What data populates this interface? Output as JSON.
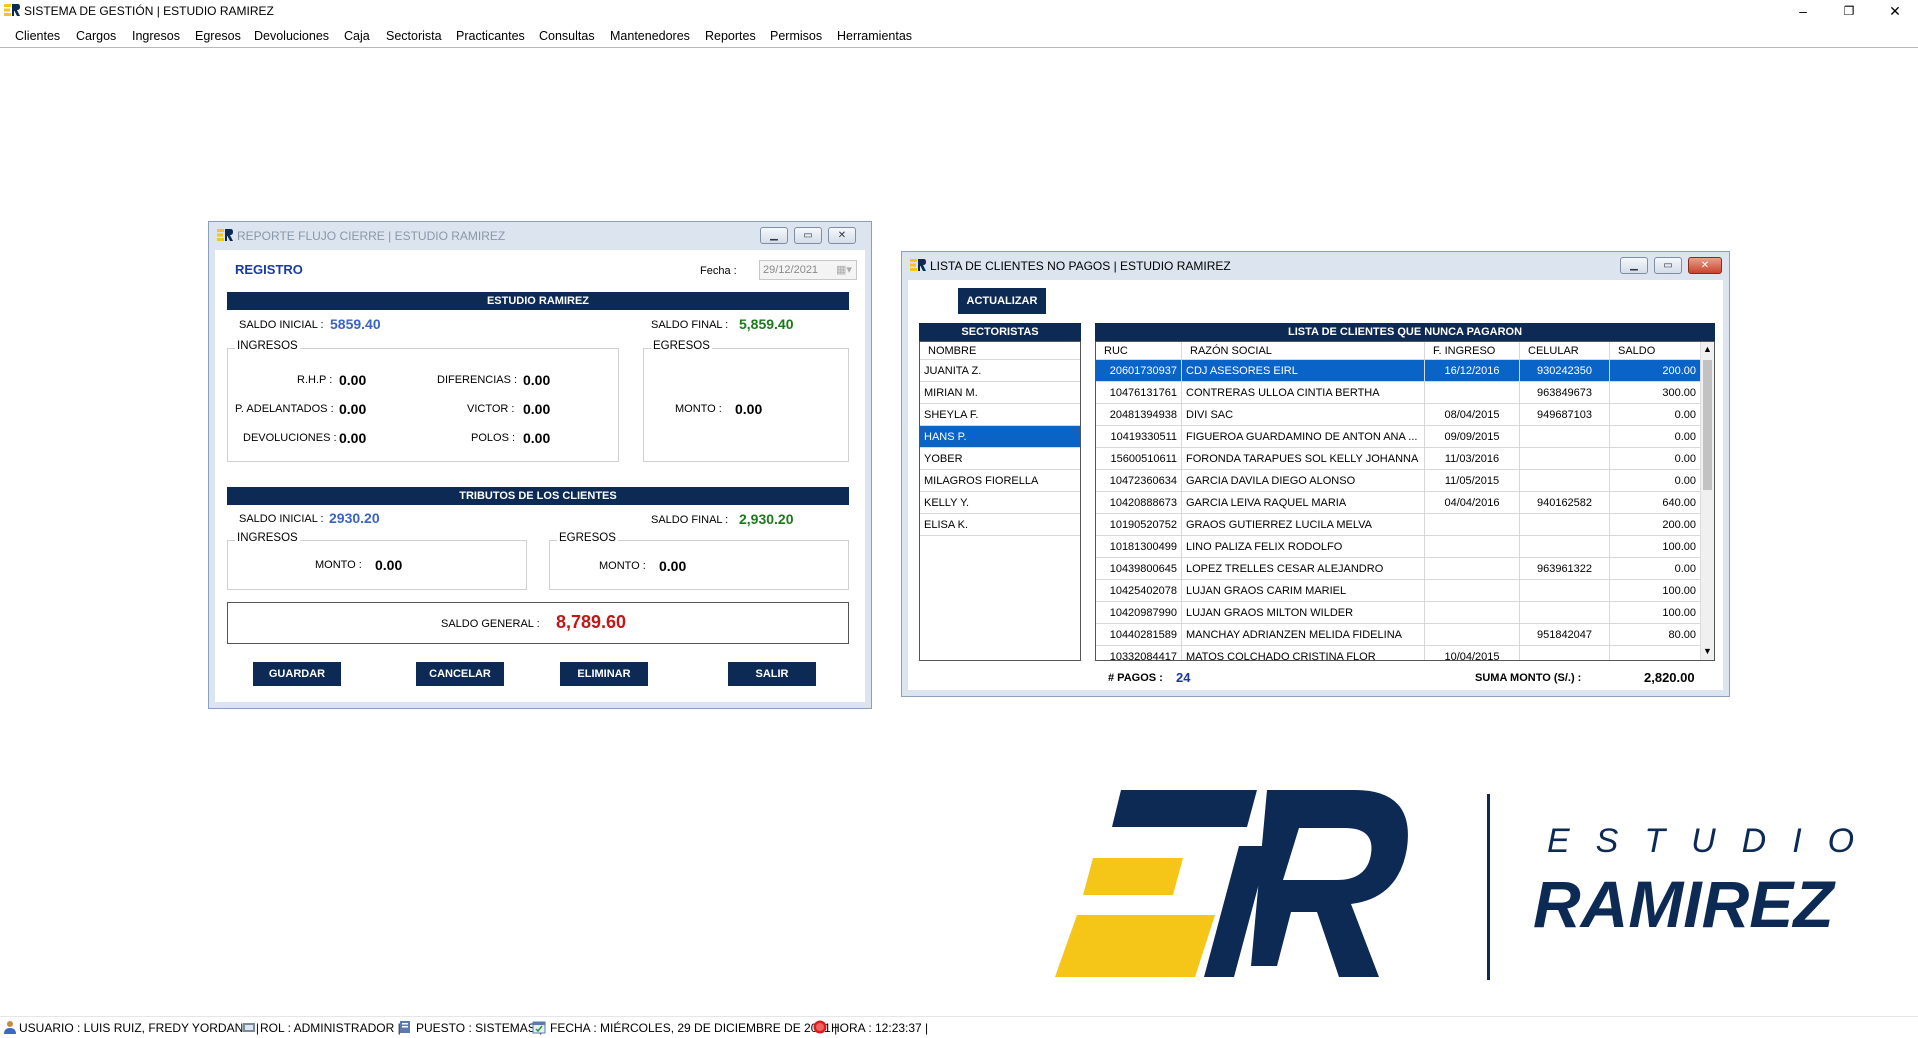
{
  "app": {
    "title": "SISTEMA DE GESTIÓN | ESTUDIO RAMIREZ",
    "menu": [
      "Clientes",
      "Cargos",
      "Ingresos",
      "Egresos",
      "Devoluciones",
      "Caja",
      "Sectorista",
      "Practicantes",
      "Consultas",
      "Mantenedores",
      "Reportes",
      "Permisos",
      "Herramientas"
    ],
    "window_controls": {
      "minimize": "–",
      "restore": "❐",
      "close": "✕"
    }
  },
  "report": {
    "title": "REPORTE FLUJO CIERRE | ESTUDIO RAMIREZ",
    "heading": "REGISTRO",
    "fecha_label": "Fecha :",
    "fecha_value": "29/12/2021",
    "estudio": {
      "bar": "ESTUDIO RAMIREZ",
      "saldo_inicial_label": "SALDO INICIAL :",
      "saldo_inicial": "5859.40",
      "saldo_final_label": "SALDO FINAL :",
      "saldo_final": "5,859.40",
      "ingresos_title": "INGRESOS",
      "rhp_label": "R.H.P :",
      "rhp": "0.00",
      "diferencias_label": "DIFERENCIAS :",
      "diferencias": "0.00",
      "adelantados_label": "P. ADELANTADOS :",
      "adelantados": "0.00",
      "victor_label": "VICTOR :",
      "victor": "0.00",
      "devoluciones_label": "DEVOLUCIONES :",
      "devoluciones": "0.00",
      "polos_label": "POLOS :",
      "polos": "0.00",
      "egresos_title": "EGRESOS",
      "monto_label": "MONTO :",
      "monto": "0.00"
    },
    "tributos": {
      "bar": "TRIBUTOS DE LOS CLIENTES",
      "saldo_inicial_label": "SALDO INICIAL :",
      "saldo_inicial": "2930.20",
      "saldo_final_label": "SALDO FINAL :",
      "saldo_final": "2,930.20",
      "ingresos_title": "INGRESOS",
      "ing_monto_label": "MONTO :",
      "ing_monto": "0.00",
      "egresos_title": "EGRESOS",
      "eg_monto_label": "MONTO :",
      "eg_monto": "0.00"
    },
    "saldo_general_label": "SALDO GENERAL :",
    "saldo_general": "8,789.60",
    "buttons": {
      "guardar": "GUARDAR",
      "cancelar": "CANCELAR",
      "eliminar": "ELIMINAR",
      "salir": "SALIR"
    }
  },
  "clients": {
    "title": "LISTA DE CLIENTES NO PAGOS | ESTUDIO RAMIREZ",
    "actualizar": "ACTUALIZAR",
    "sectoristas_bar": "SECTORISTAS",
    "sectoristas_header": "NOMBRE",
    "sectoristas": [
      "JUANITA Z.",
      "MIRIAN M.",
      "SHEYLA F.",
      "HANS P.",
      "YOBER",
      "MILAGROS FIORELLA",
      "KELLY Y.",
      "ELISA K."
    ],
    "selected_sectorista": 3,
    "list_bar": "LISTA DE CLIENTES QUE NUNCA PAGARON",
    "columns": [
      "RUC",
      "RAZÓN SOCIAL",
      "F. INGRESO",
      "CELULAR",
      "SALDO"
    ],
    "rows": [
      [
        "20601730937",
        "CDJ ASESORES EIRL",
        "16/12/2016",
        "930242350",
        "200.00"
      ],
      [
        "10476131761",
        "CONTRERAS ULLOA CINTIA BERTHA",
        "",
        "963849673",
        "300.00"
      ],
      [
        "20481394938",
        "DIVI SAC",
        "08/04/2015",
        "949687103",
        "0.00"
      ],
      [
        "10419330511",
        "FIGUEROA GUARDAMINO DE ANTON ANA ...",
        "09/09/2015",
        "",
        "0.00"
      ],
      [
        "15600510611",
        "FORONDA TARAPUES SOL KELLY JOHANNA",
        "11/03/2016",
        "",
        "0.00"
      ],
      [
        "10472360634",
        "GARCIA DAVILA DIEGO ALONSO",
        "11/05/2015",
        "",
        "0.00"
      ],
      [
        "10420888673",
        "GARCIA LEIVA RAQUEL MARIA",
        "04/04/2016",
        "940162582",
        "640.00"
      ],
      [
        "10190520752",
        "GRAOS GUTIERREZ LUCILA MELVA",
        "",
        "",
        "200.00"
      ],
      [
        "10181300499",
        "LINO PALIZA FELIX RODOLFO",
        "",
        "",
        "100.00"
      ],
      [
        "10439800645",
        "LOPEZ TRELLES CESAR ALEJANDRO",
        "",
        "963961322",
        "0.00"
      ],
      [
        "10425402078",
        "LUJAN GRAOS CARIM MARIEL",
        "",
        "",
        "100.00"
      ],
      [
        "10420987990",
        "LUJAN GRAOS MILTON WILDER",
        "",
        "",
        "100.00"
      ],
      [
        "10440281589",
        "MANCHAY ADRIANZEN MELIDA FIDELINA",
        "",
        "951842047",
        "80.00"
      ],
      [
        "10332084417",
        "MATOS COLCHADO CRISTINA FLOR",
        "10/04/2015",
        "",
        ""
      ]
    ],
    "selected_row": 0,
    "pagos_label": "# PAGOS :",
    "pagos": "24",
    "suma_label": "SUMA MONTO (S/.) :",
    "suma": "2,820.00"
  },
  "logo": {
    "line1": "ESTUDIO",
    "line2": "RAMIREZ",
    "mark": "ER",
    "navy": "#0d2a55",
    "yellow": "#f5c518"
  },
  "status": {
    "usuario": "USUARIO : LUIS RUIZ, FREDY YORDANO |",
    "rol": "ROL : ADMINISTRADOR |",
    "puesto": "PUESTO : SISTEMAS |",
    "fecha": "FECHA : MIÉRCOLES, 29 DE DICIEMBRE DE 2021 |",
    "hora": "HORA : 12:23:37 |"
  }
}
